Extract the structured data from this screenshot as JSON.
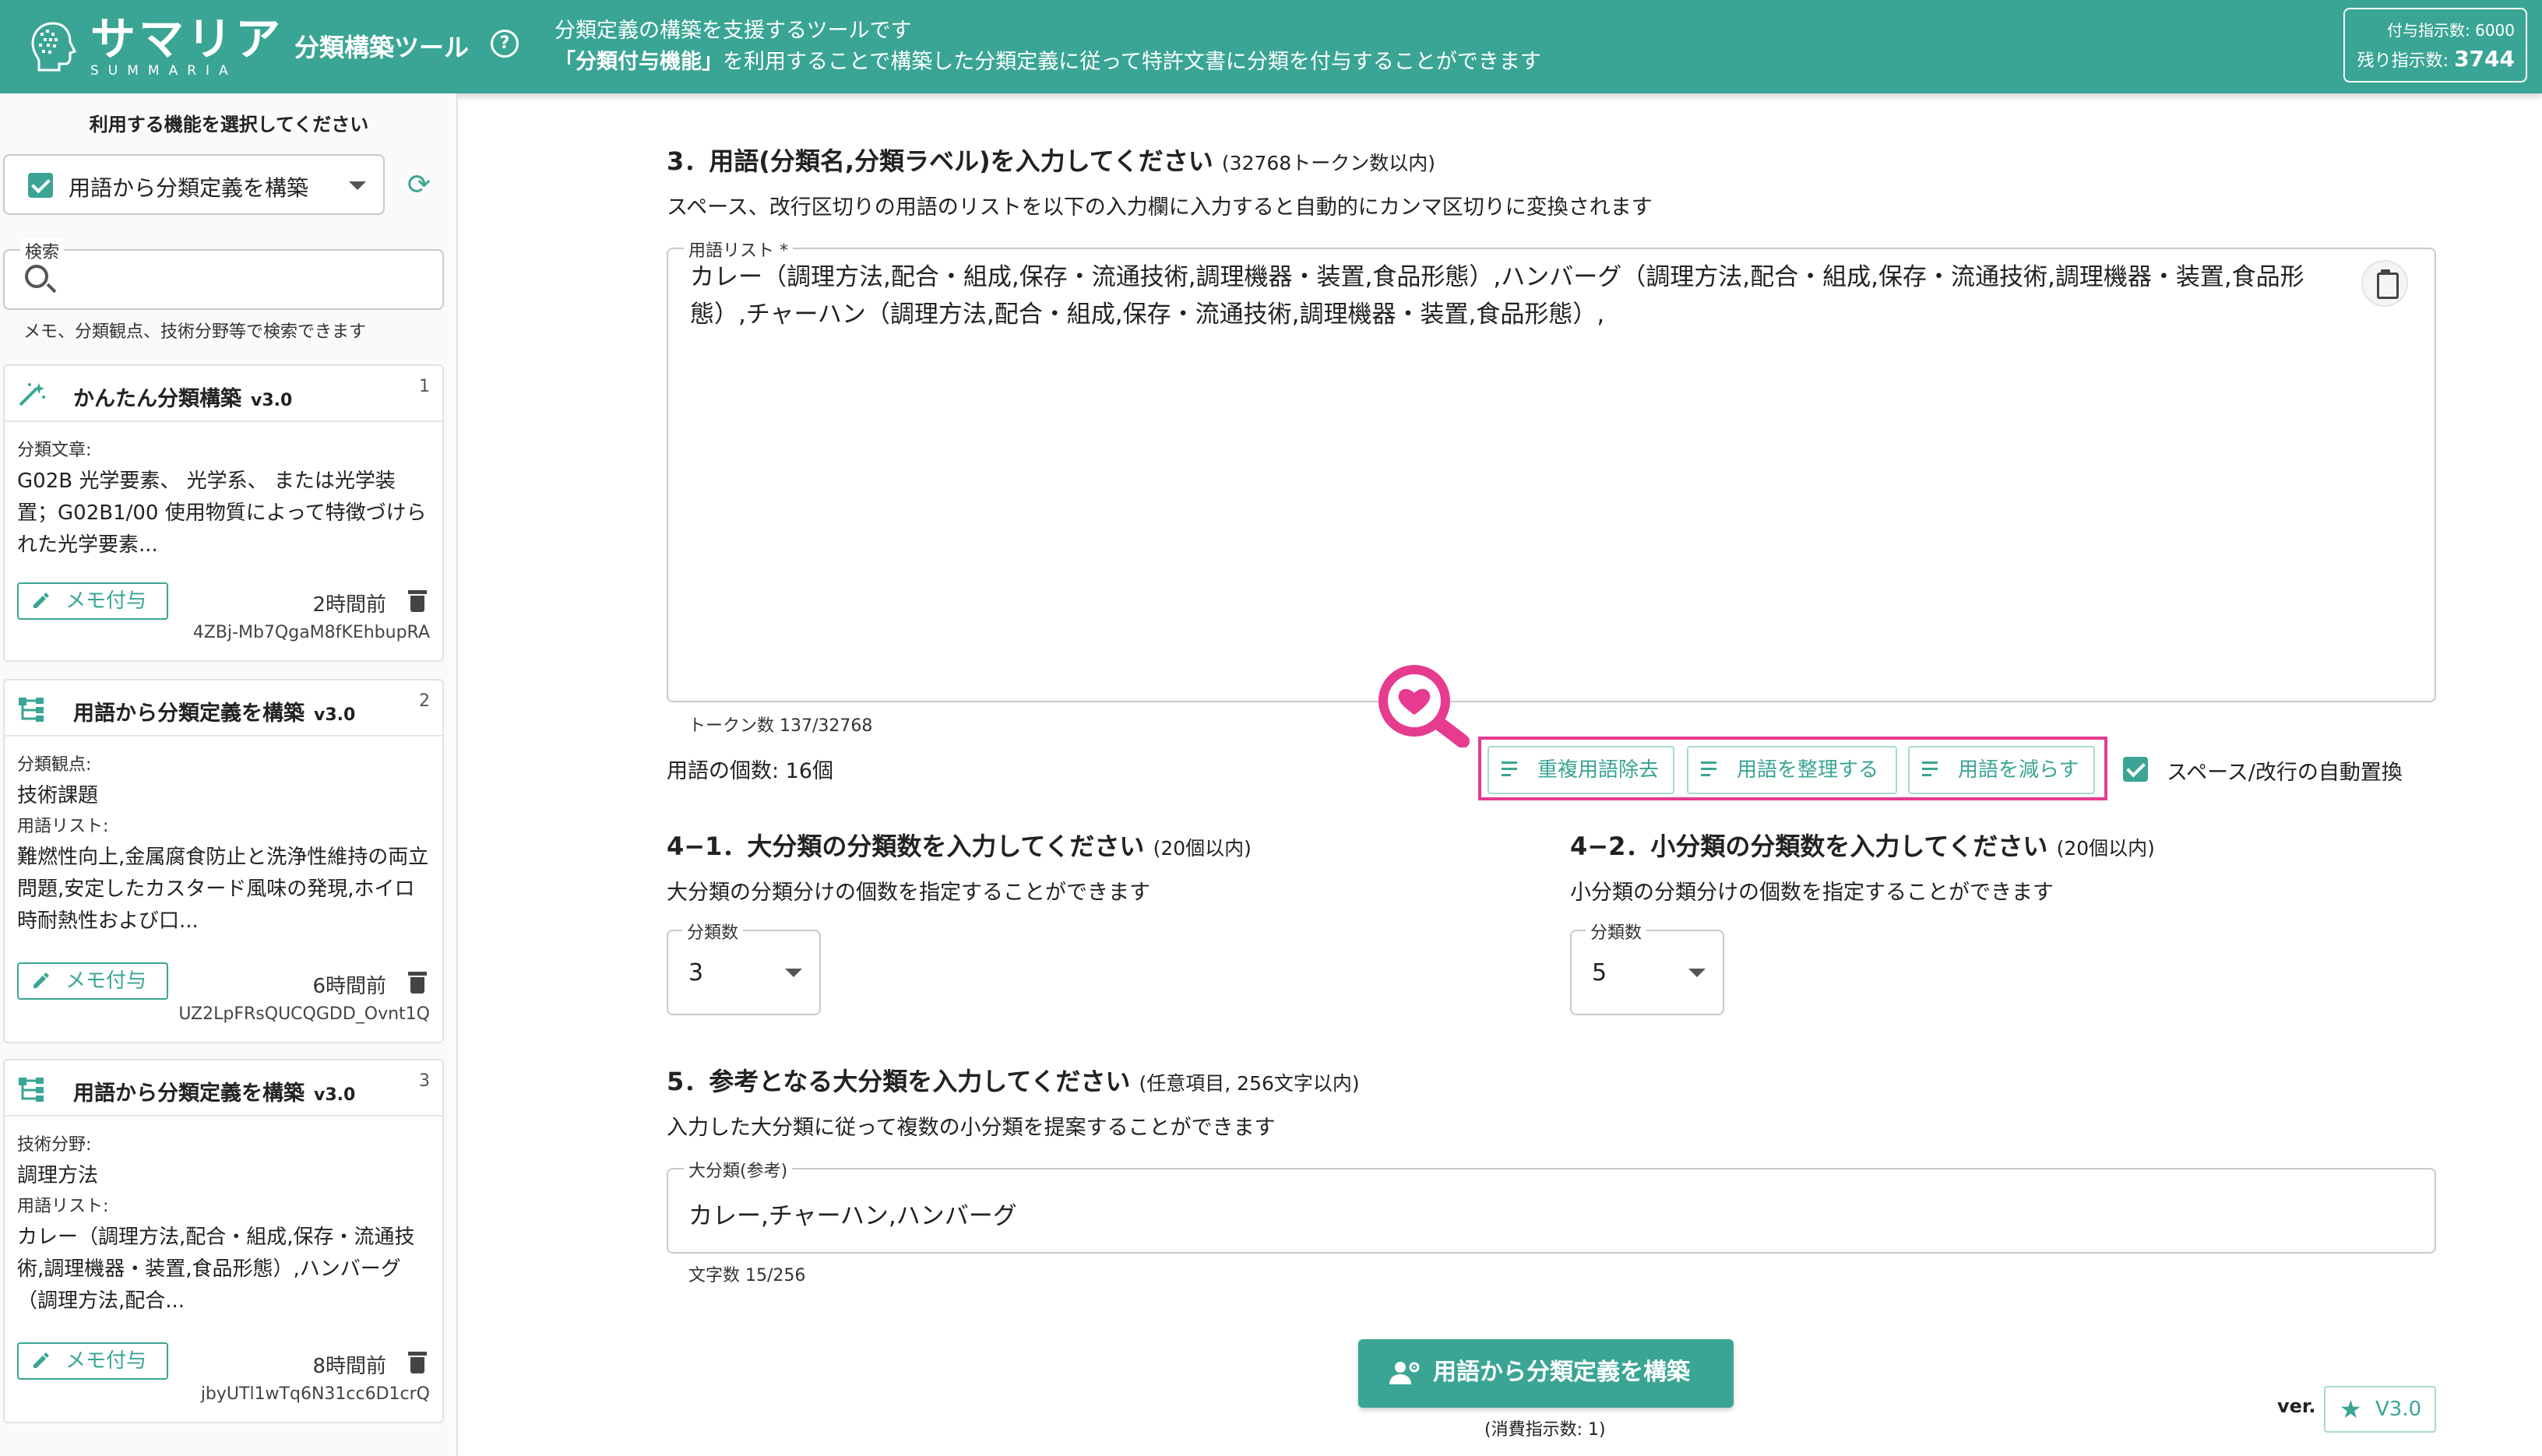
{
  "header": {
    "logo_jp": "サマリア",
    "logo_en": "SUMMARIA",
    "tool_title": "分類構築ツール",
    "help_symbol": "?",
    "desc_line1": "分類定義の構築を支援するツールです",
    "desc_line2_bold": "「分類付与機能」",
    "desc_line2_rest": "を利用することで構築した分類定義に従って特許文書に分類を付与することができます",
    "quota_total_label": "付与指示数: 6000",
    "quota_remaining_label": "残り指示数:",
    "quota_remaining_value": "3744"
  },
  "sidebar": {
    "heading": "利用する機能を選択してください",
    "selected_function": "用語から分類定義を構築",
    "search_label": "検索",
    "search_hint": "メモ、分類観点、技術分野等で検索できます",
    "cards": [
      {
        "no": "1",
        "title": "かんたん分類構築",
        "version": "v3.0",
        "icon": "magic-wand-icon",
        "field1_label": "分類文章:",
        "field1_value": "G02B 光学要素、 光学系、 または光学装置；G02B1/00 使用物質によって特徴づけられた光学要素...",
        "memo_label": "メモ付与",
        "ago": "2時間前",
        "id": "4ZBj-Mb7QgaM8fKEhbupRA"
      },
      {
        "no": "2",
        "title": "用語から分類定義を構築",
        "version": "v3.0",
        "icon": "tree-icon",
        "field1_label": "分類観点:",
        "field1_value": "技術課題",
        "field2_label": "用語リスト:",
        "field2_value": "難燃性向上,金属腐食防止と洗浄性維持の両立問題,安定したカスタード風味の発現,ホイロ時耐熱性および口...",
        "memo_label": "メモ付与",
        "ago": "6時間前",
        "id": "UZ2LpFRsQUCQGDD_Ovnt1Q"
      },
      {
        "no": "3",
        "title": "用語から分類定義を構築",
        "version": "v3.0",
        "icon": "tree-icon",
        "field1_label": "技術分野:",
        "field1_value": "調理方法",
        "field2_label": "用語リスト:",
        "field2_value": "カレー（調理方法,配合・組成,保存・流通技術,調理機器・装置,食品形態）,ハンバーグ（調理方法,配合...",
        "memo_label": "メモ付与",
        "ago": "8時間前",
        "id": "jbyUTl1wTq6N31cc6D1crQ"
      }
    ]
  },
  "main": {
    "s3_title": "3．用語(分類名,分類ラベル)を入力してください",
    "s3_sub": "(32768トークン数以内)",
    "s3_desc": "スペース、改行区切りの用語のリストを以下の入力欄に入力すると自動的にカンマ区切りに変換されます",
    "terms_label": "用語リスト *",
    "terms_value": "カレー（調理方法,配合・組成,保存・流通技術,調理機器・装置,食品形態）,ハンバーグ（調理方法,配合・組成,保存・流通技術,調理機器・装置,食品形態）,チャーハン（調理方法,配合・組成,保存・流通技術,調理機器・装置,食品形態）,",
    "token_count": "トークン数 137/32768",
    "term_count": "用語の個数: 16個",
    "btn_dedupe": "重複用語除去",
    "btn_organize": "用語を整理する",
    "btn_reduce": "用語を減らす",
    "auto_replace": "スペース/改行の自動置換",
    "s41_title": "4−1．大分類の分類数を入力してください",
    "s41_sub": "(20個以内)",
    "s41_desc": "大分類の分類分けの個数を指定することができます",
    "s41_label": "分類数",
    "s41_value": "3",
    "s42_title": "4−2．小分類の分類数を入力してください",
    "s42_sub": "(20個以内)",
    "s42_desc": "小分類の分類分けの個数を指定することができます",
    "s42_label": "分類数",
    "s42_value": "5",
    "s5_title": "5．参考となる大分類を入力してください",
    "s5_sub": "(任意項目, 256文字以内)",
    "s5_desc": "入力した大分類に従って複数の小分類を提案することができます",
    "major_label": "大分類(参考)",
    "major_value": "カレー,チャーハン,ハンバーグ",
    "char_count": "文字数 15/256",
    "build_button": "用語から分類定義を構築",
    "consume_note": "(消費指示数: 1)",
    "ver_label": "ver.",
    "ver_value": "V3.0"
  },
  "colors": {
    "brand": "#3aa594",
    "highlight": "#e63b8f"
  }
}
